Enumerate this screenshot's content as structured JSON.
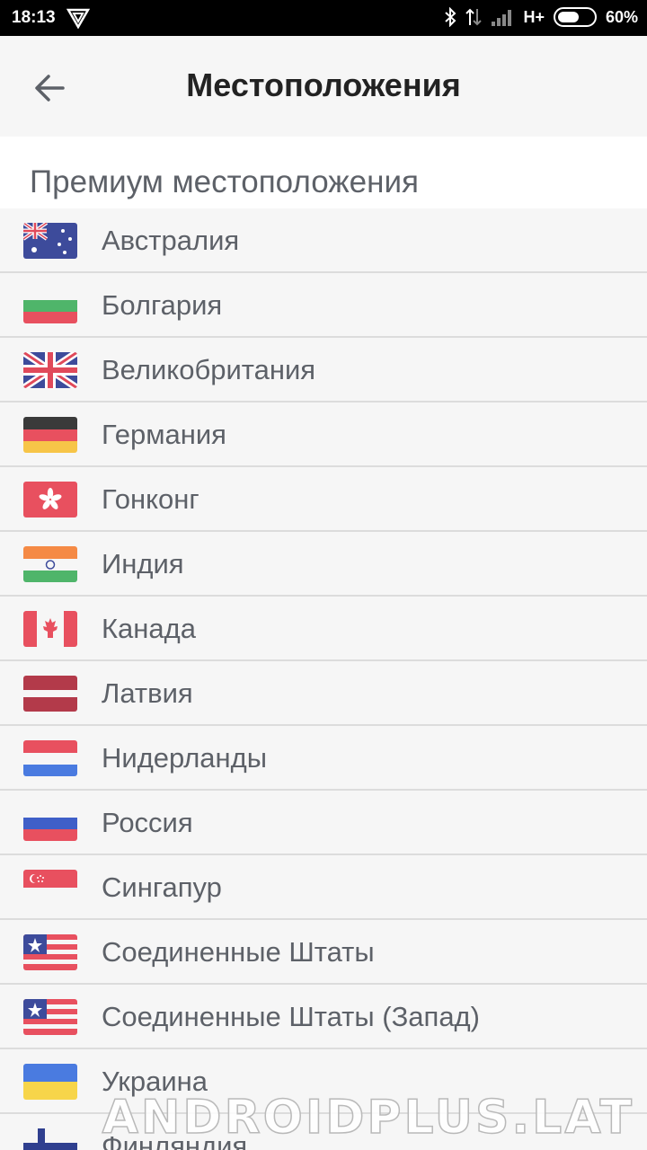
{
  "status_bar": {
    "time": "18:13",
    "network": "H+",
    "battery_text": "60%",
    "battery_level": 0.6,
    "icons": [
      "vpn-shield-icon",
      "bluetooth-icon",
      "data-transfer-icon",
      "signal-icon",
      "battery-icon"
    ]
  },
  "header": {
    "title": "Местоположения",
    "back_icon": "arrow-left-icon"
  },
  "section": {
    "label": "Премиум местоположения"
  },
  "locations": [
    {
      "name": "Австралия",
      "flag": "australia-flag-icon"
    },
    {
      "name": "Болгария",
      "flag": "bulgaria-flag-icon"
    },
    {
      "name": "Великобритания",
      "flag": "uk-flag-icon"
    },
    {
      "name": "Германия",
      "flag": "germany-flag-icon"
    },
    {
      "name": "Гонконг",
      "flag": "hong-kong-flag-icon"
    },
    {
      "name": "Индия",
      "flag": "india-flag-icon"
    },
    {
      "name": "Канада",
      "flag": "canada-flag-icon"
    },
    {
      "name": "Латвия",
      "flag": "latvia-flag-icon"
    },
    {
      "name": "Нидерланды",
      "flag": "netherlands-flag-icon"
    },
    {
      "name": "Россия",
      "flag": "russia-flag-icon"
    },
    {
      "name": "Сингапур",
      "flag": "singapore-flag-icon"
    },
    {
      "name": "Соединенные Штаты",
      "flag": "usa-flag-icon"
    },
    {
      "name": "Соединенные Штаты (Запад)",
      "flag": "usa-flag-icon"
    },
    {
      "name": "Украина",
      "flag": "ukraine-flag-icon"
    },
    {
      "name": "Финляндия",
      "flag": "finland-flag-icon"
    }
  ],
  "colors": {
    "text": "#5d6168",
    "title": "#222222",
    "divider": "#dcdcdc",
    "background": "#f6f6f6"
  },
  "watermark": "ANDROIDPLUS.LAT"
}
